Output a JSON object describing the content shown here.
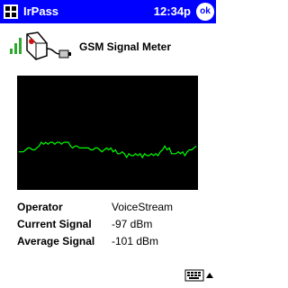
{
  "titlebar": {
    "app_name": "IrPass",
    "time": "12:34p",
    "ok_label": "ok"
  },
  "header": {
    "title": "GSM Signal Meter"
  },
  "graph": {
    "line_color": "#00ff00",
    "background_color": "#000000",
    "signal_dbm": [
      -100,
      -100,
      -100,
      -99,
      -98,
      -98,
      -99,
      -99,
      -98,
      -97,
      -95,
      -96,
      -95,
      -96,
      -95,
      -95,
      -96,
      -95,
      -95,
      -96,
      -95,
      -95,
      -95,
      -97,
      -98,
      -97,
      -97,
      -98,
      -98,
      -98,
      -98,
      -98,
      -99,
      -99,
      -98,
      -98,
      -99,
      -100,
      -99,
      -98,
      -99,
      -98,
      -100,
      -99,
      -101,
      -101,
      -100,
      -101,
      -103,
      -101,
      -102,
      -102,
      -101,
      -102,
      -101,
      -103,
      -101,
      -102,
      -102,
      -101,
      -102,
      -101,
      -102,
      -100,
      -99,
      -97,
      -99,
      -98,
      -101,
      -101,
      -101,
      -100,
      -101,
      -100,
      -102,
      -100,
      -99,
      -99,
      -98,
      -97
    ]
  },
  "info": {
    "operator_label": "Operator",
    "operator_value": "VoiceStream",
    "current_label": "Current Signal",
    "current_value": "-97 dBm",
    "average_label": "Average Signal",
    "average_value": "-101 dBm"
  },
  "colors": {
    "titlebar": "#0000ff",
    "titlebar_text": "#ffffff"
  }
}
